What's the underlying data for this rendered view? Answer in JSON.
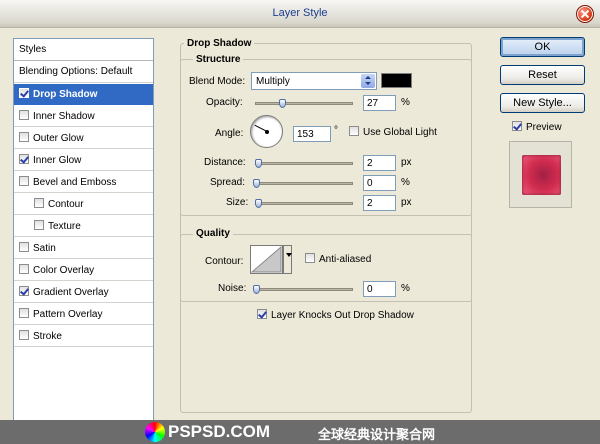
{
  "window": {
    "title": "Layer Style"
  },
  "styles_panel": {
    "header": "Styles",
    "items": [
      {
        "label": "Blending Options: Default",
        "has_checkbox": false,
        "checked": false,
        "selected": false,
        "indent": false
      },
      {
        "label": "Drop Shadow",
        "has_checkbox": true,
        "checked": true,
        "selected": true,
        "indent": false
      },
      {
        "label": "Inner Shadow",
        "has_checkbox": true,
        "checked": false,
        "selected": false,
        "indent": false
      },
      {
        "label": "Outer Glow",
        "has_checkbox": true,
        "checked": false,
        "selected": false,
        "indent": false
      },
      {
        "label": "Inner Glow",
        "has_checkbox": true,
        "checked": true,
        "selected": false,
        "indent": false
      },
      {
        "label": "Bevel and Emboss",
        "has_checkbox": true,
        "checked": false,
        "selected": false,
        "indent": false
      },
      {
        "label": "Contour",
        "has_checkbox": true,
        "checked": false,
        "selected": false,
        "indent": true
      },
      {
        "label": "Texture",
        "has_checkbox": true,
        "checked": false,
        "selected": false,
        "indent": true
      },
      {
        "label": "Satin",
        "has_checkbox": true,
        "checked": false,
        "selected": false,
        "indent": false
      },
      {
        "label": "Color Overlay",
        "has_checkbox": true,
        "checked": false,
        "selected": false,
        "indent": false
      },
      {
        "label": "Gradient Overlay",
        "has_checkbox": true,
        "checked": true,
        "selected": false,
        "indent": false
      },
      {
        "label": "Pattern Overlay",
        "has_checkbox": true,
        "checked": false,
        "selected": false,
        "indent": false
      },
      {
        "label": "Stroke",
        "has_checkbox": true,
        "checked": false,
        "selected": false,
        "indent": false
      }
    ]
  },
  "drop_shadow": {
    "title": "Drop Shadow",
    "structure": {
      "title": "Structure",
      "blend_mode_label": "Blend Mode:",
      "blend_mode_value": "Multiply",
      "shadow_color": "#000000",
      "opacity_label": "Opacity:",
      "opacity_value": "27",
      "opacity_unit": "%",
      "angle_label": "Angle:",
      "angle_value": "153",
      "angle_unit": "°",
      "global_light_label": "Use Global Light",
      "global_light_checked": false,
      "distance_label": "Distance:",
      "distance_value": "2",
      "distance_unit": "px",
      "spread_label": "Spread:",
      "spread_value": "0",
      "spread_unit": "%",
      "size_label": "Size:",
      "size_value": "2",
      "size_unit": "px"
    },
    "quality": {
      "title": "Quality",
      "contour_label": "Contour:",
      "anti_aliased_label": "Anti-aliased",
      "anti_aliased_checked": false,
      "noise_label": "Noise:",
      "noise_value": "0",
      "noise_unit": "%"
    },
    "knockout_label": "Layer Knocks Out Drop Shadow",
    "knockout_checked": true
  },
  "buttons": {
    "ok": "OK",
    "reset": "Reset",
    "new_style": "New Style...",
    "preview_label": "Preview",
    "preview_checked": true
  },
  "footer": {
    "brand": "PSPSD.COM",
    "tagline": "全球经典设计聚合网"
  }
}
